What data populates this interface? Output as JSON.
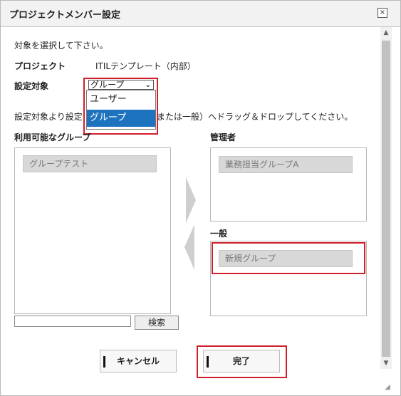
{
  "dialog": {
    "title": "プロジェクトメンバー設定",
    "close_icon": "×"
  },
  "instructions": "対象を選択して下さい。",
  "project": {
    "label": "プロジェクト",
    "value": "ITILテンプレート（内部）"
  },
  "target": {
    "label": "設定対象",
    "selected": "グループ",
    "options": [
      "ユーザー",
      "グループ"
    ]
  },
  "drag_hint_left": "設定対象より設定",
  "drag_hint_right": "または一般）へドラッグ＆ドロップしてください。",
  "available": {
    "label": "利用可能なグループ",
    "items": [
      "グループテスト"
    ]
  },
  "admins": {
    "label": "管理者",
    "items": [
      "業務担当グループA"
    ]
  },
  "general": {
    "label": "一般",
    "items": [
      "新規グループ"
    ]
  },
  "search": {
    "value": "",
    "button": "検索"
  },
  "buttons": {
    "cancel": "キャンセル",
    "done": "完了"
  },
  "colors": {
    "highlight": "#d11f2b",
    "selected_option": "#1e73be"
  }
}
